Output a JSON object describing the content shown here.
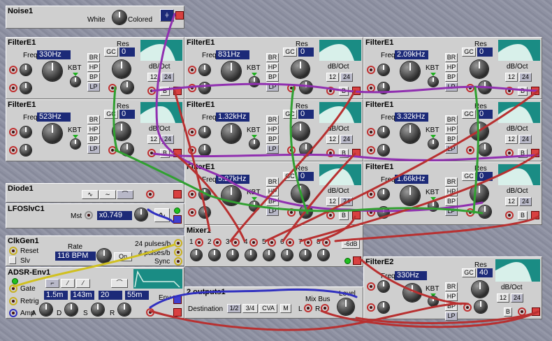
{
  "noise": {
    "title": "Noise1",
    "white": "White",
    "colored": "Colored"
  },
  "filters": [
    {
      "title": "FilterE1",
      "freq": "330Hz",
      "kbt": "KBT",
      "res": "Res",
      "gc": "GC",
      "res_val": "0",
      "dboct": "dB/Oct",
      "o12": "12",
      "o24": "24",
      "b": "B"
    },
    {
      "title": "FilterE1",
      "freq": "831Hz",
      "kbt": "KBT",
      "res": "Res",
      "gc": "GC",
      "res_val": "0",
      "dboct": "dB/Oct",
      "o12": "12",
      "o24": "24",
      "b": "B"
    },
    {
      "title": "FilterE1",
      "freq": "2.09kHz",
      "kbt": "KBT",
      "res": "Res",
      "gc": "GC",
      "res_val": "0",
      "dboct": "dB/Oct",
      "o12": "12",
      "o24": "24",
      "b": "B"
    },
    {
      "title": "FilterE1",
      "freq": "523Hz",
      "kbt": "KBT",
      "res": "Res",
      "gc": "GC",
      "res_val": "0",
      "dboct": "dB/Oct",
      "o12": "12",
      "o24": "24",
      "b": "B"
    },
    {
      "title": "FilterE1",
      "freq": "1.32kHz",
      "kbt": "KBT",
      "res": "Res",
      "gc": "GC",
      "res_val": "0",
      "dboct": "dB/Oct",
      "o12": "12",
      "o24": "24",
      "b": "B"
    },
    {
      "title": "FilterE1",
      "freq": "3.32kHz",
      "kbt": "KBT",
      "res": "Res",
      "gc": "GC",
      "res_val": "0",
      "dboct": "dB/Oct",
      "o12": "12",
      "o24": "24",
      "b": "B"
    },
    {
      "title": "FilterE1",
      "freq": "5.27kHz",
      "kbt": "KBT",
      "res": "Res",
      "gc": "GC",
      "res_val": "0",
      "dboct": "dB/Oct",
      "o12": "12",
      "o24": "24",
      "b": "B"
    },
    {
      "title": "FilterE1",
      "freq": "1.66kHz",
      "kbt": "KBT",
      "res": "Res",
      "gc": "GC",
      "res_val": "0",
      "dboct": "dB/Oct",
      "o12": "12",
      "o24": "24",
      "b": "B"
    }
  ],
  "filter_mode_buttons": [
    "BR",
    "HP",
    "BP",
    "LP"
  ],
  "freq_label": "Freq",
  "diode": {
    "title": "Diode1"
  },
  "lfo": {
    "title": "LFOSlvC1",
    "mst": "Mst",
    "value": "x0.749"
  },
  "clk": {
    "title": "ClkGen1",
    "rate": "Rate",
    "bpm": "116 BPM",
    "on": "On",
    "reset": "Reset",
    "slv": "Slv",
    "p24": "24 pulses/b",
    "p4": "4 pulses/b",
    "sync": "Sync"
  },
  "adsr": {
    "title": "ADSR-Env1",
    "gate": "Gate",
    "retrig": "Retrig",
    "amp": "Amp",
    "a": "A",
    "d": "D",
    "s": "S",
    "r": "R",
    "env": "Env",
    "a_val": "1.5m",
    "d_val": "143m",
    "s_val": "20",
    "r_val": "55m"
  },
  "mixer": {
    "title": "Mixer1",
    "ch": [
      "1",
      "2",
      "3",
      "4",
      "5",
      "6",
      "7",
      "8"
    ],
    "db": "-6dB"
  },
  "filter2": {
    "title": "FilterE2",
    "freq": "330Hz",
    "kbt": "KBT",
    "res": "Res",
    "gc": "GC",
    "res_val": "40",
    "dboct": "dB/Oct",
    "o12": "12",
    "o24": "24",
    "b": "B",
    "modes": [
      "BR",
      "HP",
      "BP",
      "LP"
    ]
  },
  "outputs": {
    "title": "2 outputs1",
    "destination": "Destination",
    "d12": "1/2",
    "d34": "3/4",
    "cva": "CVA",
    "m": "M",
    "mixbus": "Mix Bus",
    "level": "Level",
    "l": "L",
    "r": "R"
  },
  "colors": {
    "panel": "#cfcfcf",
    "display": "#1c2a78",
    "scope": "#1a8c84",
    "cable_red": "#b83030",
    "cable_green": "#30a030",
    "cable_purple": "#9030b0",
    "cable_blue": "#3030c0",
    "cable_yellow": "#d0c020"
  }
}
